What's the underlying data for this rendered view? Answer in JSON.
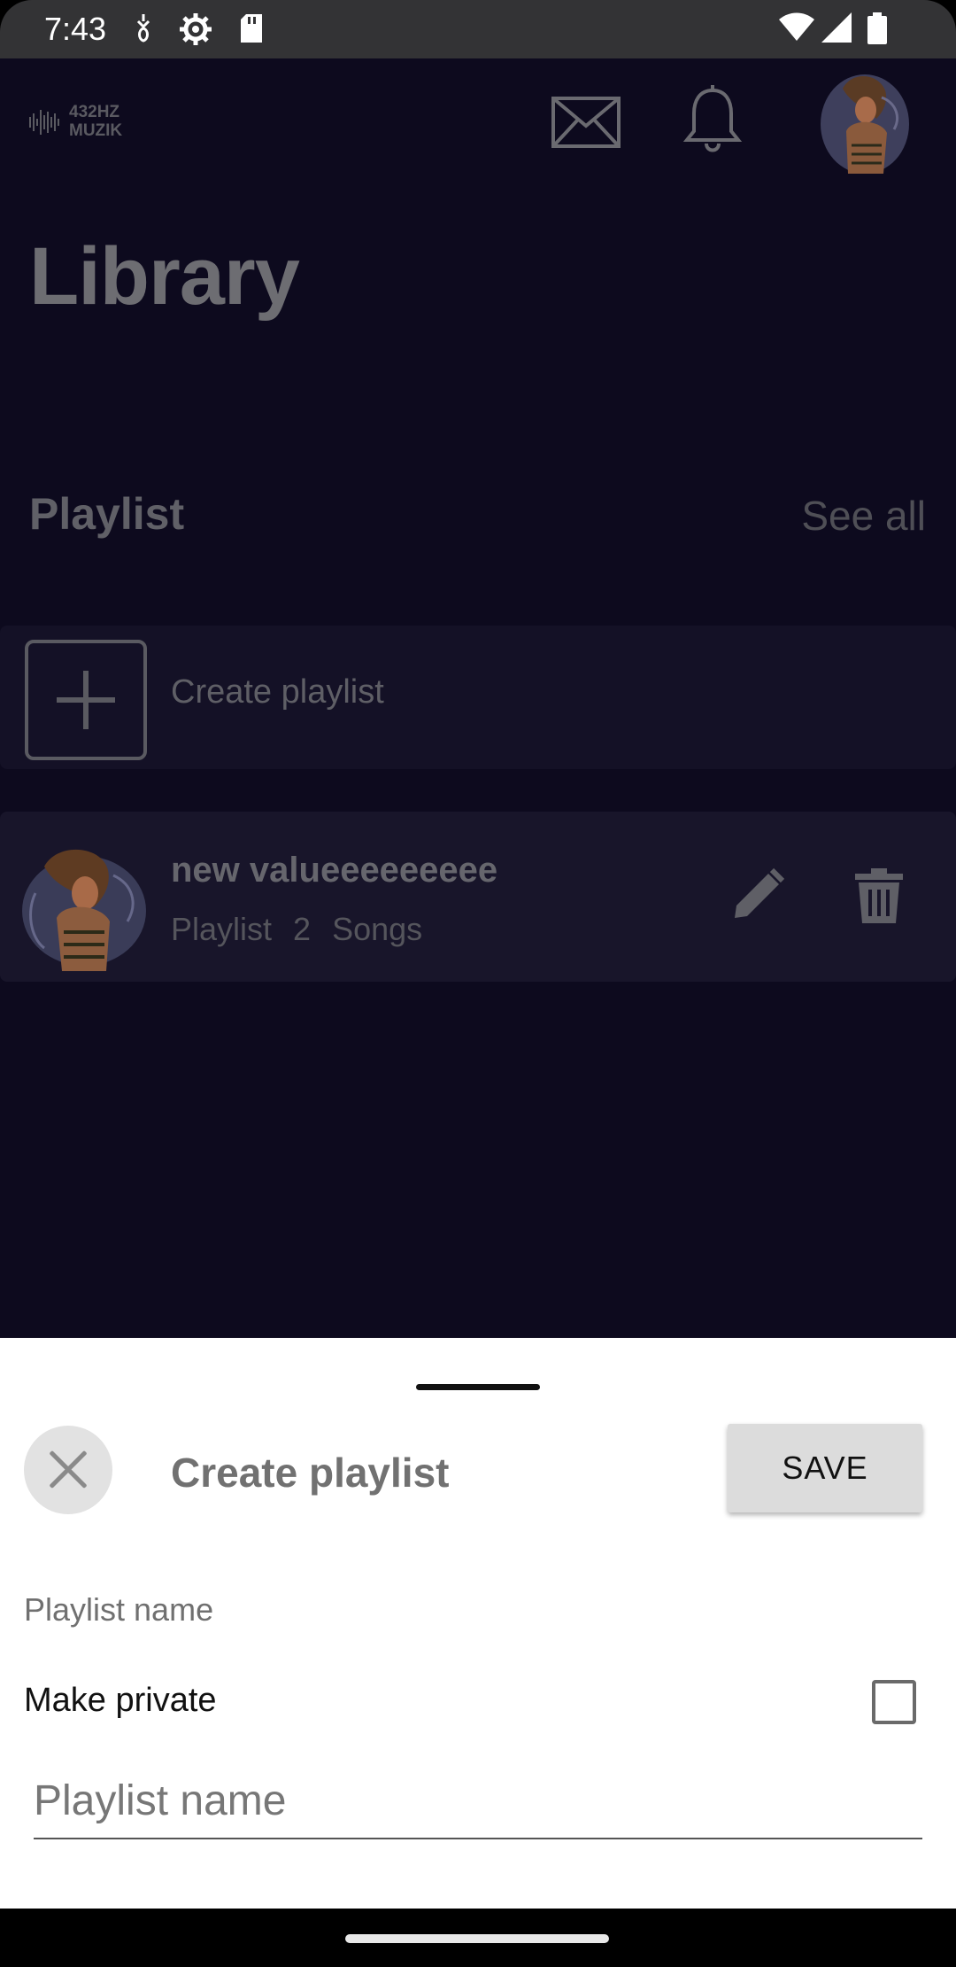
{
  "status_bar": {
    "time": "7:43",
    "icons": [
      "location-pin-icon",
      "settings-gear-icon",
      "sd-card-icon",
      "wifi-icon",
      "signal-icon",
      "battery-icon"
    ]
  },
  "header": {
    "logo_text": "432HZ MUZIK",
    "icons": [
      "mail-icon",
      "bell-icon",
      "profile-avatar"
    ]
  },
  "library": {
    "title": "Library",
    "playlist_section": {
      "title": "Playlist",
      "see_all": "See all",
      "create_label": "Create playlist",
      "items": [
        {
          "name": "new valueeeeeeeee",
          "type": "Playlist",
          "count": "2",
          "unit": "Songs"
        }
      ]
    }
  },
  "sheet": {
    "title": "Create playlist",
    "save_label": "SAVE",
    "field_label": "Playlist name",
    "private_label": "Make private",
    "private_checked": false,
    "input_placeholder": "Playlist name",
    "input_value": ""
  },
  "colors": {
    "app_background": "#0d0a1e",
    "sheet_background": "#ffffff",
    "save_button": "#dcdcdc"
  }
}
